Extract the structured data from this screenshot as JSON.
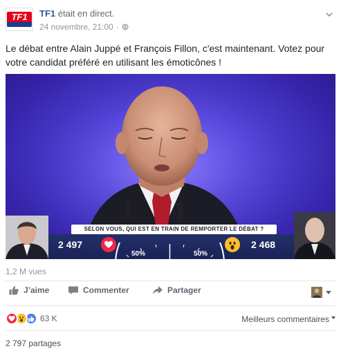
{
  "post": {
    "page_name": "TF1",
    "status": "était en direct.",
    "date": "24 novembre, 21:00",
    "separator": "·",
    "privacy_icon": "globe-icon",
    "logo_text": "TF1",
    "text": "Le débat entre Alain Juppé et François Fillon, c'est maintenant. Votez pour votre candidat préféré en utilisant les émoticônes !"
  },
  "video": {
    "question": "SELON VOUS, QUI EST EN TRAIN DE REMPORTER LE DÉBAT ?",
    "left_votes": "2 497",
    "right_votes": "2 468",
    "left_pct": "50%",
    "right_pct": "50%",
    "left_emoji": "heart-love-icon",
    "right_emoji": "wow-icon",
    "colors": {
      "background": "#3d2fb5",
      "bar": "#24306a",
      "love": "#f0284a",
      "wow": "#fcbf2c"
    }
  },
  "stats": {
    "views": "1,2 M vues",
    "reaction_count": "63 K",
    "shares": "2 797 partages",
    "sort": "Meilleurs commentaires"
  },
  "actions": {
    "like": "J’aime",
    "comment": "Commenter",
    "share": "Partager"
  }
}
